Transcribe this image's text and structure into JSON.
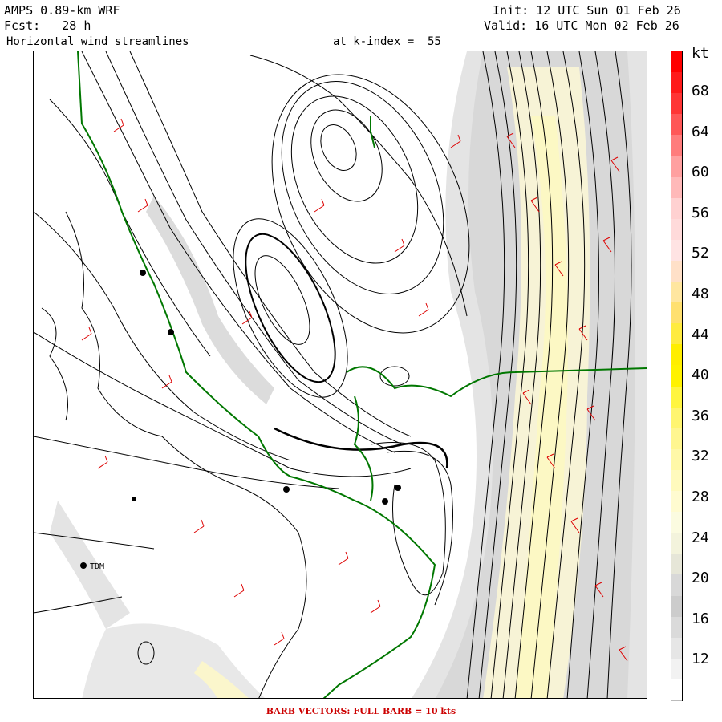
{
  "header": {
    "model": "AMPS 0.89-km WRF",
    "forecast_label": "Fcst:",
    "forecast_value": "28 h",
    "field": "Horizontal wind streamlines",
    "level": "at k-index =  55",
    "init": "Init: 12 UTC Sun 01 Feb 26",
    "valid": "Valid: 16 UTC Mon 02 Feb 26"
  },
  "footer": "BARB VECTORS:  FULL BARB = 10 kts",
  "colorbar": {
    "unit": "kt",
    "labels": [
      "68",
      "64",
      "60",
      "56",
      "52",
      "48",
      "44",
      "40",
      "36",
      "32",
      "28",
      "24",
      "20",
      "16",
      "12"
    ],
    "colors": [
      "#ff0000",
      "#ff1a1a",
      "#ff3535",
      "#ff5757",
      "#ff7c7c",
      "#ffa0a0",
      "#ffb9b9",
      "#ffd1d1",
      "#ffdada",
      "#ffe3e3",
      "#ffe0c8",
      "#ffe6a0",
      "#ffe070",
      "#ffeb40",
      "#ffee00",
      "#fff200",
      "#fff540",
      "#fff570",
      "#fff690",
      "#fff8a8",
      "#fffabd",
      "#fffbd0",
      "#fbfbe0",
      "#f3f3dc",
      "#e6e6d8",
      "#d8d8d8",
      "#cccccc",
      "#dadada",
      "#e6e6e6",
      "#f2f2f2",
      "#ffffff"
    ]
  },
  "map": {
    "station_label": "TDM",
    "icons": {
      "station": "station-dot-icon"
    },
    "colors": {
      "coast": "#000000",
      "streamline": "#000000",
      "border": "#007700",
      "barb": "#dd0000"
    }
  }
}
